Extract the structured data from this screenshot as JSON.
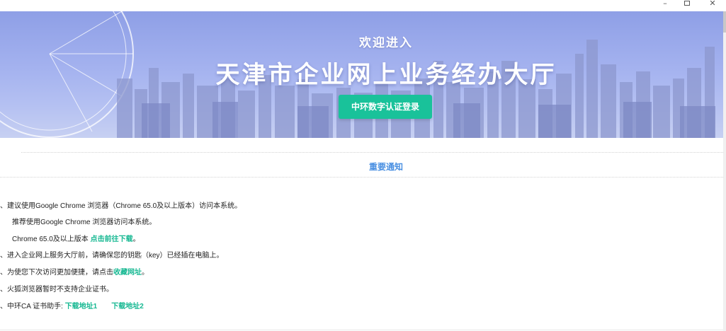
{
  "window": {
    "minimize": "–",
    "close": "✕"
  },
  "banner": {
    "welcome": "欢迎进入",
    "title": "天津市企业网上业务经办大厅",
    "login_button": "中环数字认证登录"
  },
  "notice": {
    "title": "重要通知",
    "items": [
      {
        "prefix": "、建议使用Google Chrome 浏览器（Chrome 65.0及以上版本）访问本系统。"
      },
      {
        "prefix": "推荐使用Google Chrome 浏览器访问本系统。"
      },
      {
        "prefix": "Chrome 65.0及以上版本 ",
        "link": "点击前往下载",
        "suffix": "。"
      },
      {
        "prefix": "、进入企业网上服务大厅前，请确保您的钥匙（key）已经插在电脑上。"
      },
      {
        "prefix": "、为使您下次访问更加便捷，请点击",
        "link": "收藏网址",
        "suffix": "。"
      },
      {
        "prefix": "、火狐浏览器暂时不支持企业证书。"
      },
      {
        "prefix": "、中环CA 证书助手: ",
        "link": "下载地址1",
        "link2": "下载地址2"
      }
    ]
  }
}
